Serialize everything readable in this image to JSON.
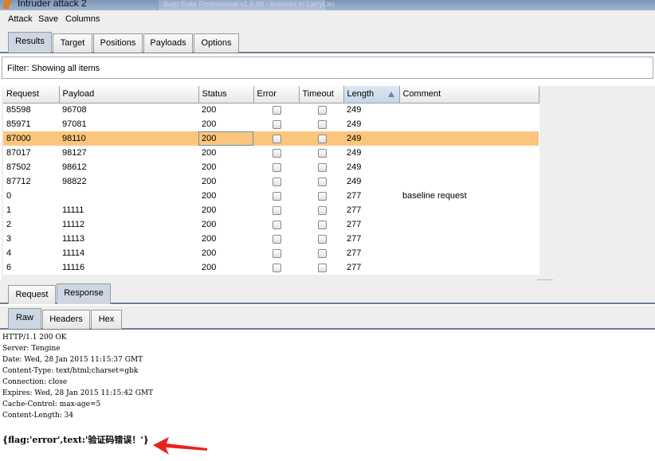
{
  "window": {
    "title": "Intruder attack 2",
    "background_window": "Burp Suite Professional v1.6.09 - licensed to LarryLau"
  },
  "menu": [
    "Attack",
    "Save",
    "Columns"
  ],
  "main_tabs": [
    {
      "label": "Results",
      "active": true
    },
    {
      "label": "Target",
      "active": false
    },
    {
      "label": "Positions",
      "active": false
    },
    {
      "label": "Payloads",
      "active": false
    },
    {
      "label": "Options",
      "active": false
    }
  ],
  "filter": {
    "text": "Filter:  Showing all items"
  },
  "results_table": {
    "columns": [
      "Request",
      "Payload",
      "Status",
      "Error",
      "Timeout",
      "Length",
      "Comment"
    ],
    "sorted_column": "Length",
    "rows": [
      {
        "request": "85598",
        "payload": "96708",
        "status": "200",
        "error": false,
        "timeout": false,
        "length": "249",
        "comment": ""
      },
      {
        "request": "85971",
        "payload": "97081",
        "status": "200",
        "error": false,
        "timeout": false,
        "length": "249",
        "comment": ""
      },
      {
        "request": "87000",
        "payload": "98110",
        "status": "200",
        "error": false,
        "timeout": false,
        "length": "249",
        "comment": "",
        "selected": true
      },
      {
        "request": "87017",
        "payload": "98127",
        "status": "200",
        "error": false,
        "timeout": false,
        "length": "249",
        "comment": ""
      },
      {
        "request": "87502",
        "payload": "98612",
        "status": "200",
        "error": false,
        "timeout": false,
        "length": "249",
        "comment": ""
      },
      {
        "request": "87712",
        "payload": "98822",
        "status": "200",
        "error": false,
        "timeout": false,
        "length": "249",
        "comment": ""
      },
      {
        "request": "0",
        "payload": "",
        "status": "200",
        "error": false,
        "timeout": false,
        "length": "277",
        "comment": "baseline request"
      },
      {
        "request": "1",
        "payload": "11111",
        "status": "200",
        "error": false,
        "timeout": false,
        "length": "277",
        "comment": ""
      },
      {
        "request": "2",
        "payload": "11112",
        "status": "200",
        "error": false,
        "timeout": false,
        "length": "277",
        "comment": ""
      },
      {
        "request": "3",
        "payload": "11113",
        "status": "200",
        "error": false,
        "timeout": false,
        "length": "277",
        "comment": ""
      },
      {
        "request": "4",
        "payload": "11114",
        "status": "200",
        "error": false,
        "timeout": false,
        "length": "277",
        "comment": ""
      },
      {
        "request": "6",
        "payload": "11116",
        "status": "200",
        "error": false,
        "timeout": false,
        "length": "277",
        "comment": ""
      }
    ]
  },
  "request_tabs": [
    {
      "label": "Request",
      "active": false
    },
    {
      "label": "Response",
      "active": true
    }
  ],
  "view_tabs": [
    {
      "label": "Raw",
      "active": true
    },
    {
      "label": "Headers",
      "active": false
    },
    {
      "label": "Hex",
      "active": false
    }
  ],
  "response": {
    "headers": [
      "HTTP/1.1 200 OK",
      "Server: Tengine",
      "Date: Wed, 28 Jan 2015 11:15:37 GMT",
      "Content-Type: text/html;charset=gbk",
      "Connection: close",
      "Expires: Wed, 28 Jan 2015 11:15:42 GMT",
      "Cache-Control: max-age=5",
      "Content-Length: 34"
    ],
    "body": "{flag:'error',text:'验证码错误！'}"
  },
  "colors": {
    "selected_row": "#fbc67b",
    "active_tab": "#cdd7e3",
    "annotation_arrow": "#e8231f"
  }
}
